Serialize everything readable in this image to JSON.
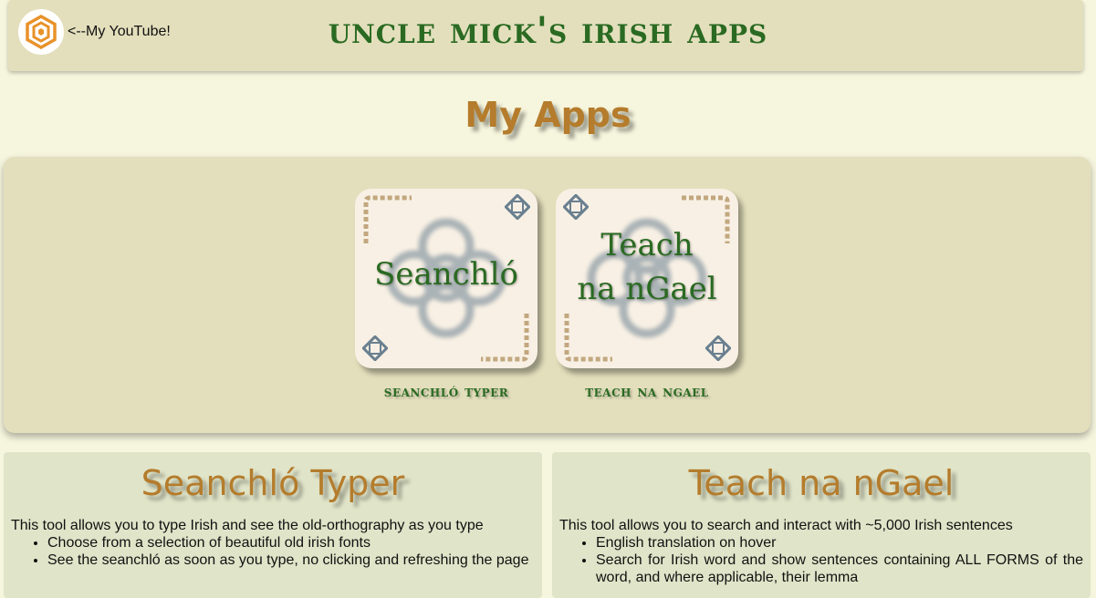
{
  "header": {
    "youtube_link": "<--My YouTube!",
    "site_title": "uncle mick's irish apps"
  },
  "section_title": "My Apps",
  "apps": [
    {
      "card_lines": [
        "Seanchló"
      ],
      "caption": "seanchló typer"
    },
    {
      "card_lines": [
        "Teach",
        "na nGael"
      ],
      "caption": "teach na ngael"
    }
  ],
  "panels": [
    {
      "title": "Seanchló Typer",
      "intro": "This tool allows you to type Irish and see the old-orthography as you type",
      "items": [
        "Choose from a selection of beautiful old irish fonts",
        "See the seanchló as soon as you type, no clicking and refreshing the page"
      ]
    },
    {
      "title": "Teach na nGael",
      "intro": "This tool allows you to search and interact with ~5,000 Irish sentences",
      "items": [
        "English translation on hover",
        "Search for Irish word and show sentences containing ALL FORMS of the word, and where applicable, their lemma"
      ]
    }
  ],
  "colors": {
    "background": "#f6f5dd",
    "panel": "#e3dfbc",
    "title_green": "#2a6a22",
    "heading_gold": "#b47c2c",
    "youtube_orange": "#e8922a"
  },
  "icons": [
    "youtube-hexagon-icon",
    "celtic-knot-icon",
    "celtic-corner-icon"
  ]
}
